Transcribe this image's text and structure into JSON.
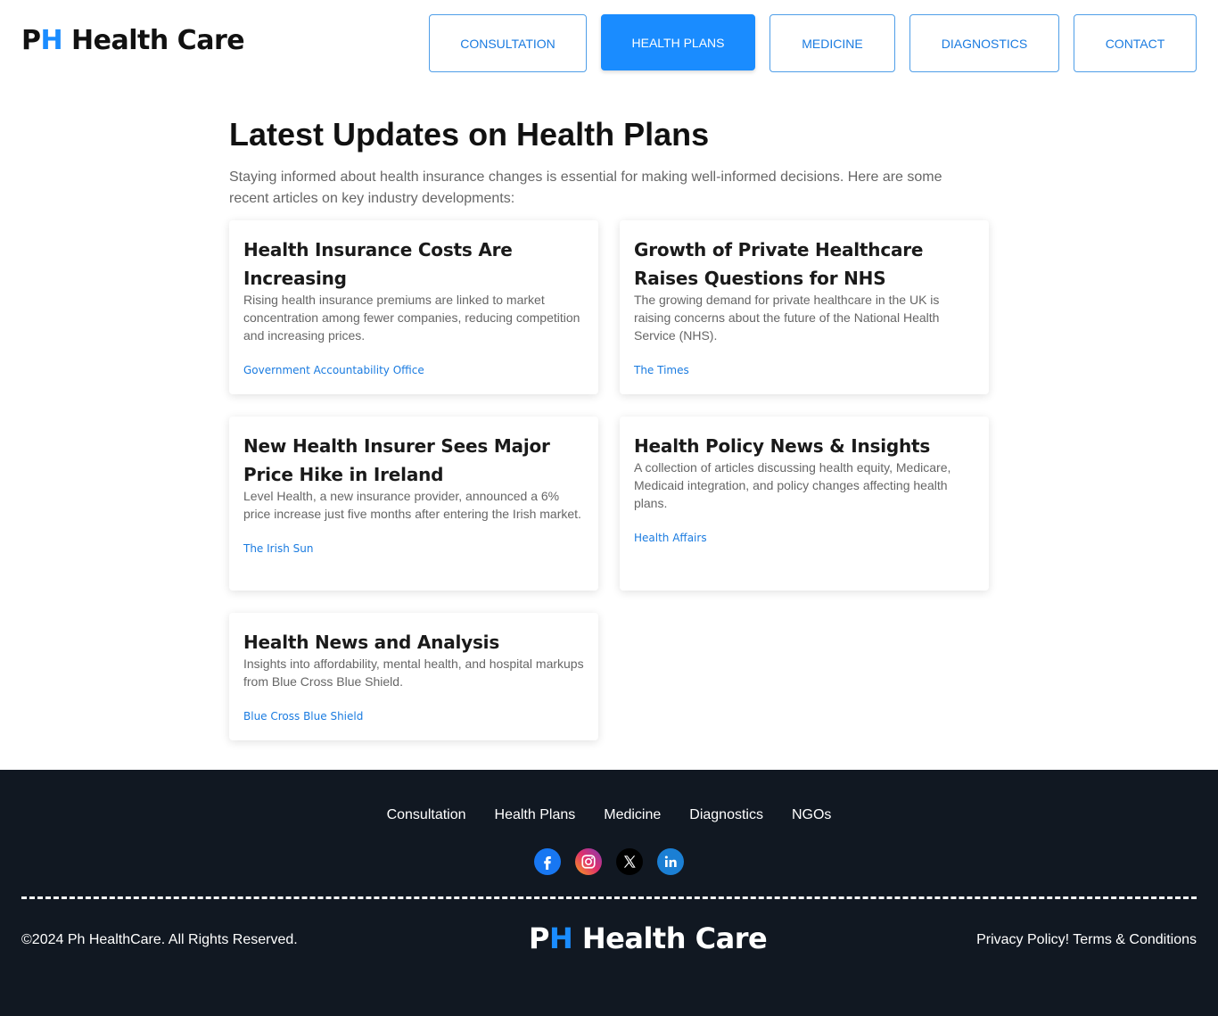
{
  "brand": {
    "prefix_p": "P",
    "prefix_h": "H",
    "name": " Health Care"
  },
  "nav": [
    {
      "label": "CONSULTATION"
    },
    {
      "label": "HEALTH PLANS",
      "active": true
    },
    {
      "label": "MEDICINE"
    },
    {
      "label": "DIAGNOSTICS"
    },
    {
      "label": "CONTACT"
    }
  ],
  "main": {
    "title": "Latest Updates on Health Plans",
    "intro": "Staying informed about health insurance changes is essential for making well-informed decisions. Here are some recent articles on key industry developments:",
    "articles": [
      {
        "title": "Health Insurance Costs Are Increasing",
        "summary": "Rising health insurance premiums are linked to market concentration among fewer companies, reducing competition and increasing prices.",
        "source": "Government Accountability Office"
      },
      {
        "title": "Growth of Private Healthcare Raises Questions for NHS",
        "summary": "The growing demand for private healthcare in the UK is raising concerns about the future of the National Health Service (NHS).",
        "source": "The Times"
      },
      {
        "title": "New Health Insurer Sees Major Price Hike in Ireland",
        "summary": "Level Health, a new insurance provider, announced a 6% price increase just five months after entering the Irish market.",
        "source": "The Irish Sun"
      },
      {
        "title": "Health Policy News & Insights",
        "summary": "A collection of articles discussing health equity, Medicare, Medicaid integration, and policy changes affecting health plans.",
        "source": "Health Affairs"
      },
      {
        "title": "Health News and Analysis",
        "summary": "Insights into affordability, mental health, and hospital markups from Blue Cross Blue Shield.",
        "source": "Blue Cross Blue Shield"
      }
    ]
  },
  "footer": {
    "links": [
      "Consultation",
      "Health Plans",
      "Medicine",
      "Diagnostics",
      "NGOs"
    ],
    "socials": [
      "facebook-icon",
      "instagram-icon",
      "x-icon",
      "linkedin-icon"
    ],
    "copyright": "©2024 Ph HealthCare. All Rights Reserved.",
    "legal": "Privacy Policy! Terms & Conditions"
  },
  "colors": {
    "accent": "#1a8cff",
    "footer_bg": "#111822"
  }
}
